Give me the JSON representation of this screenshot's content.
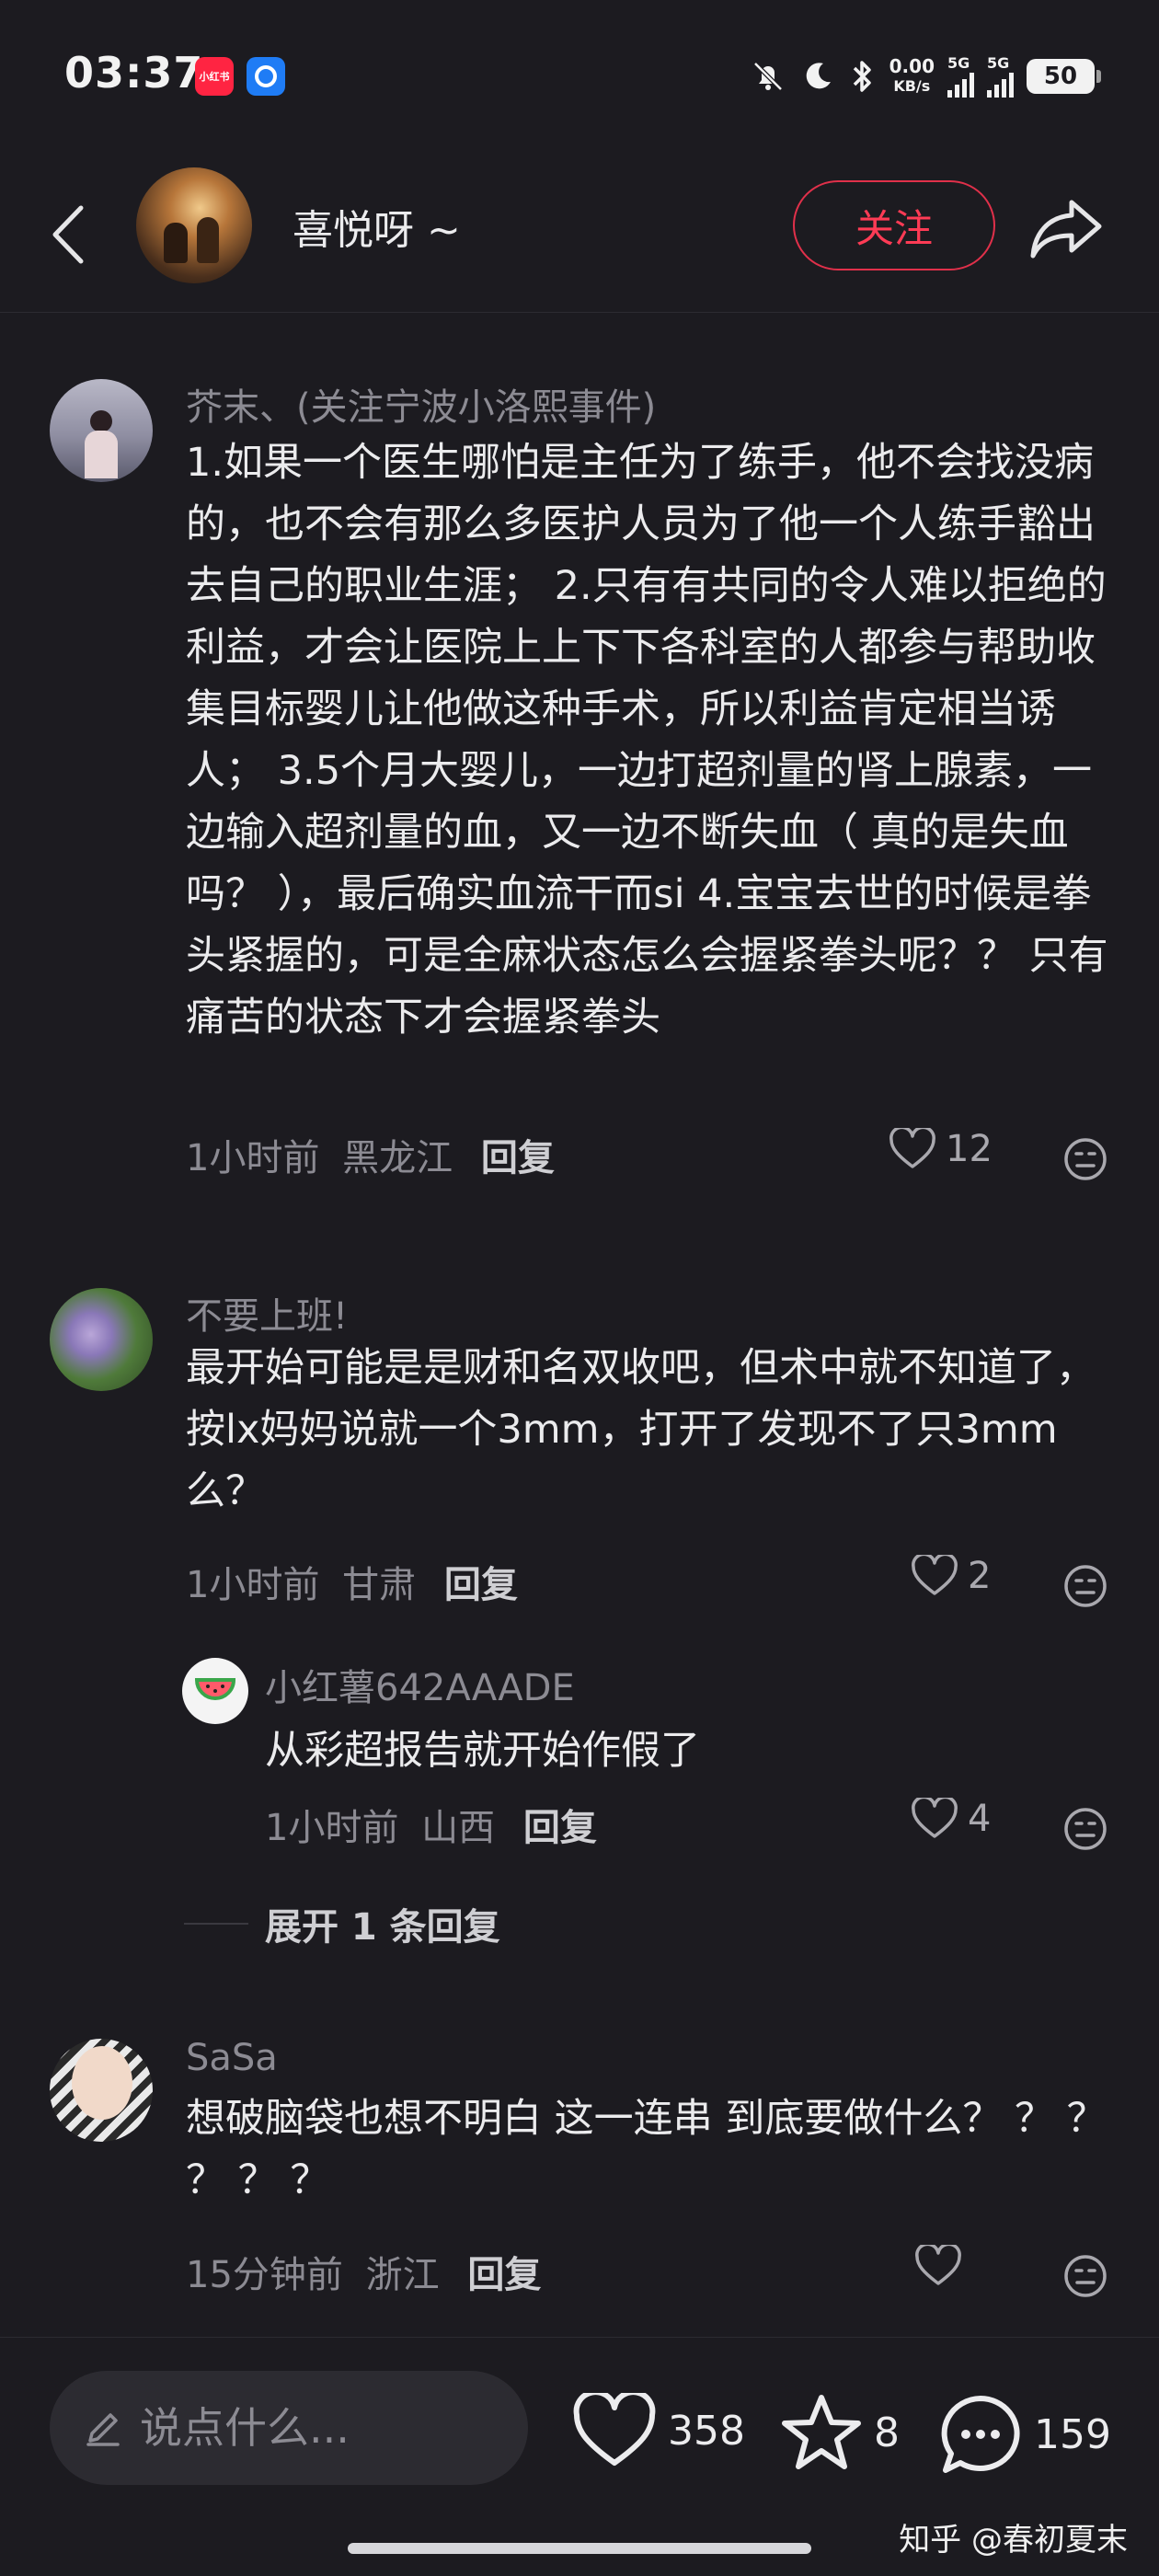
{
  "status_bar": {
    "time": "03:37",
    "app_badge_1": "小红书",
    "net_speed_value": "0.00",
    "net_speed_unit": "KB/s",
    "signal_1_label": "5G",
    "signal_2_label": "5G",
    "battery": "50",
    "icons": [
      "mute-icon",
      "moon-icon",
      "bluetooth-icon"
    ]
  },
  "header": {
    "username": "喜悦呀 ~",
    "follow_label": "关注",
    "accent": "#ff3b55"
  },
  "comments": [
    {
      "name": "芥末、(关注宁波小洛熙事件)",
      "text": "1.如果一个医生哪怕是主任为了练手，他不会找没病的，也不会有那么多医护人员为了他一个人练手豁出去自己的职业生涯； 2.只有有共同的令人难以拒绝的利益，才会让医院上上下下各科室的人都参与帮助收集目标婴儿让他做这种手术，所以利益肯定相当诱人； 3.5个月大婴儿，一边打超剂量的肾上腺素，一边输入超剂量的血，又一边不断失血（ 真的是失血吗？ ），最后确实血流干而si 4.宝宝去世的时候是拳头紧握的，可是全麻状态怎么会握紧拳头呢？？ 只有痛苦的状态下才会握紧拳头",
      "time": "1小时前",
      "location": "黑龙江",
      "reply_label": "回复",
      "likes": "12"
    },
    {
      "name": "不要上班!",
      "text": "最开始可能是是财和名双收吧，但术中就不知道了，按lx妈妈说就一个3mm，打开了发现不了只3mm么？",
      "time": "1小时前",
      "location": "甘肃",
      "reply_label": "回复",
      "likes": "2",
      "sub_reply": {
        "name": "小红薯642AAADE",
        "text": "从彩超报告就开始作假了",
        "time": "1小时前",
        "location": "山西",
        "reply_label": "回复",
        "likes": "4"
      },
      "expand_label": "展开 1 条回复"
    },
    {
      "name": "SaSa",
      "text": "想破脑袋也想不明白 这一连串 到底要做什么？ ？ ？ ？ ？ ？",
      "time": "15分钟前",
      "location": "浙江",
      "reply_label": "回复",
      "likes": ""
    }
  ],
  "bottom_bar": {
    "input_placeholder": "说点什么...",
    "like_count": "358",
    "star_count": "8",
    "comment_count": "159"
  },
  "watermark": "知乎 @春初夏末"
}
